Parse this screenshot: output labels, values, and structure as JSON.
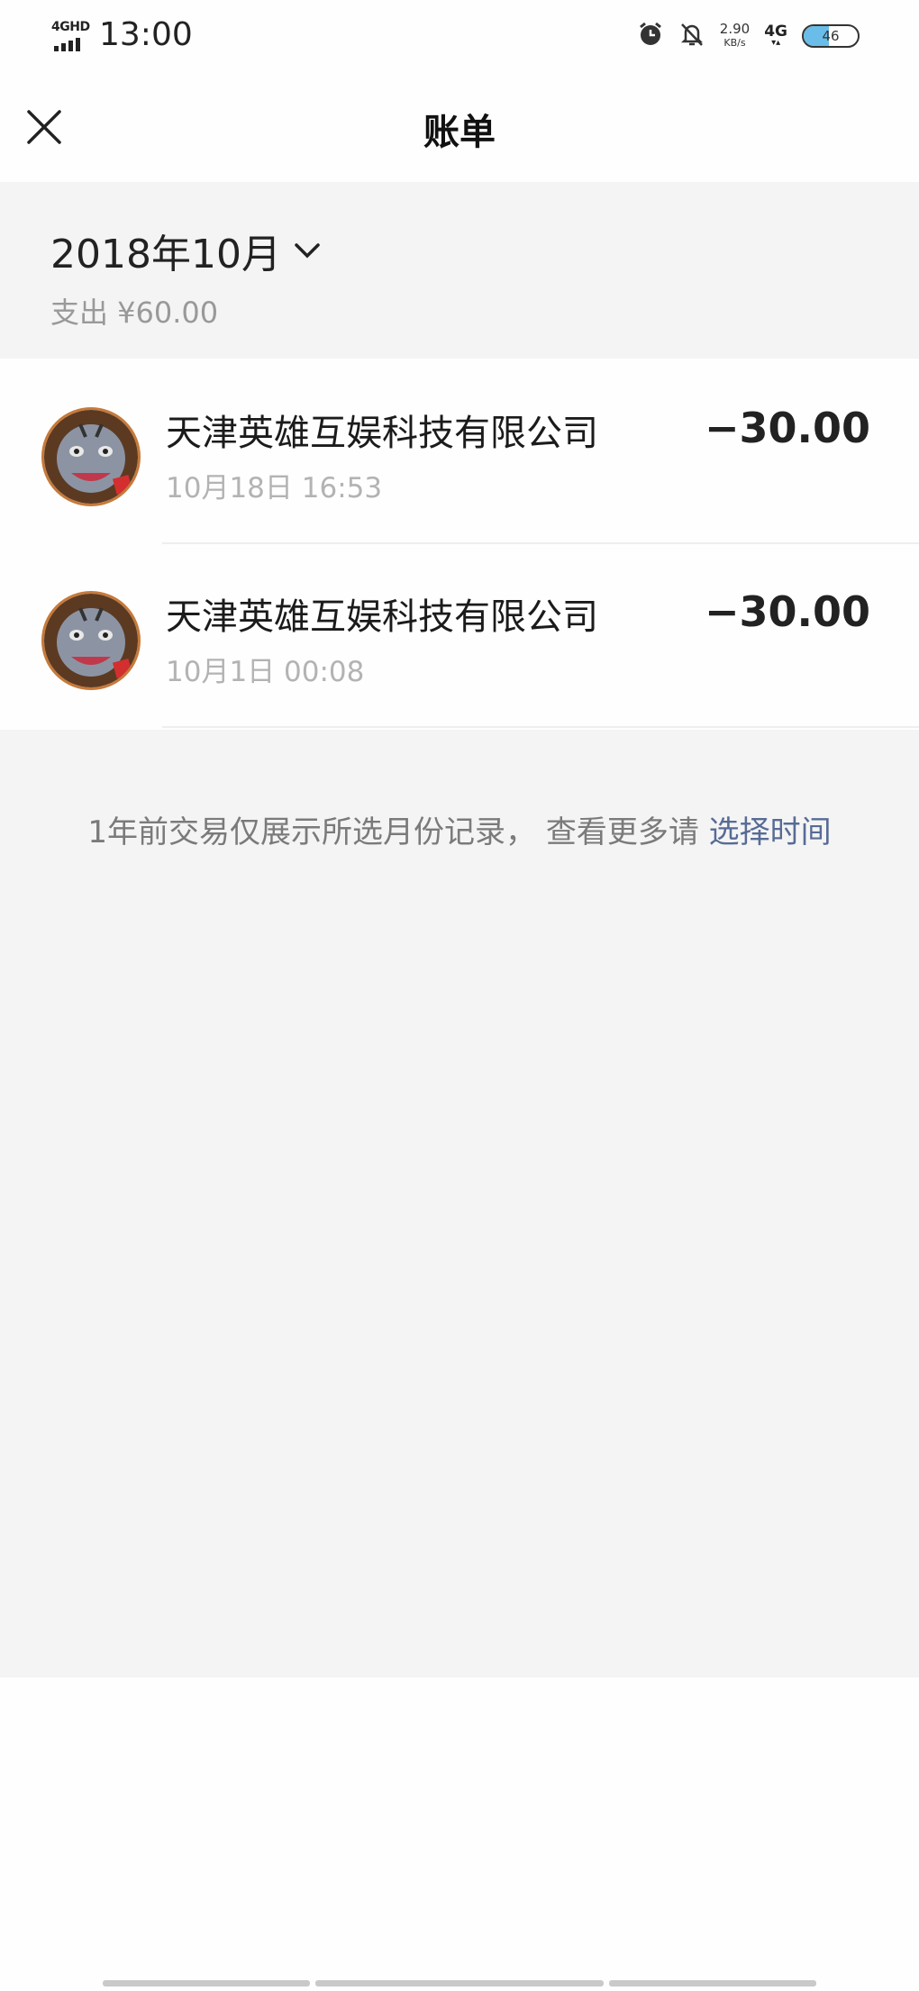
{
  "status_bar": {
    "network_label": "4GHD",
    "time": "13:00",
    "speed_value": "2.90",
    "speed_unit": "KB/s",
    "cell_label": "4G",
    "battery_level": "46",
    "battery_fraction": 0.46,
    "battery_color": "#69bde8"
  },
  "header": {
    "title": "账单"
  },
  "summary": {
    "month": "2018年10月",
    "spend": "支出 ¥60.00"
  },
  "transactions": [
    {
      "merchant": "天津英雄互娱科技有限公司",
      "time": "10月18日 16:53",
      "amount": "−30.00",
      "avatar_icon": "merchant-avatar"
    },
    {
      "merchant": "天津英雄互娱科技有限公司",
      "time": "10月1日 00:08",
      "amount": "−30.00",
      "avatar_icon": "merchant-avatar"
    }
  ],
  "footer": {
    "note": "1年前交易仅展示所选月份记录， 查看更多请 ",
    "link": "选择时间",
    "link_color": "#576b95"
  }
}
